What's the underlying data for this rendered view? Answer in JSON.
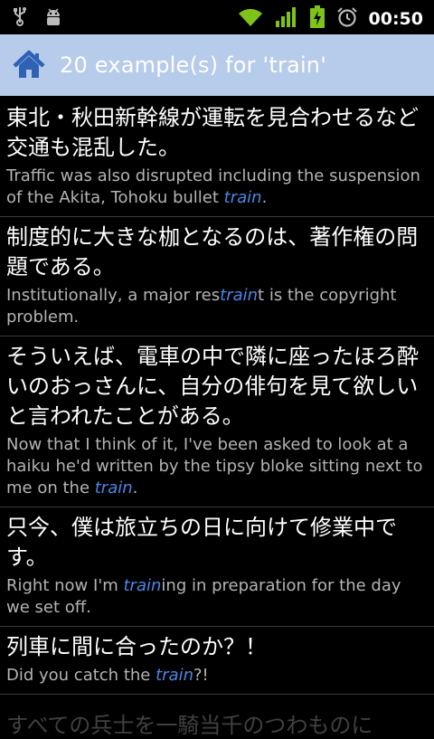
{
  "status_bar": {
    "time": "00:50",
    "icons": [
      "usb-icon",
      "android-debug-icon",
      "wifi-icon",
      "signal-icon",
      "battery-charging-icon",
      "alarm-icon"
    ]
  },
  "header": {
    "title": "20 example(s) for 'train'",
    "home_icon": "home-icon",
    "accent": "#b7cbea"
  },
  "highlight_color": "#4a86e8",
  "examples": [
    {
      "japanese": "東北・秋田新幹線が運転を見合わせるなど交通も混乱した。",
      "english_before": "Traffic was also disrupted including the suspension of the Akita, Tohoku bullet ",
      "english_match": "train",
      "english_after": "."
    },
    {
      "japanese": "制度的に大きな枷となるのは、著作権の問題である。",
      "english_before": "Institutionally, a major res",
      "english_match": "train",
      "english_after": "t is the copyright problem."
    },
    {
      "japanese": "そういえば、電車の中で隣に座ったほろ酔いのおっさんに、自分の俳句を見て欲しいと言われたことがある。",
      "english_before": "Now that I think of it, I've been asked to look at a haiku he'd written by the tipsy bloke sitting next to me on the ",
      "english_match": "train",
      "english_after": "."
    },
    {
      "japanese": "只今、僕は旅立ちの日に向けて修業中です。",
      "english_before": "Right now I'm ",
      "english_match": "train",
      "english_after": "ing in preparation for the day we set off."
    },
    {
      "japanese": "列車に間に合ったのか？！",
      "english_before": "Did you catch the ",
      "english_match": "train",
      "english_after": "?!"
    }
  ],
  "partial_next": "すべての兵士を一騎当千のつわものに"
}
